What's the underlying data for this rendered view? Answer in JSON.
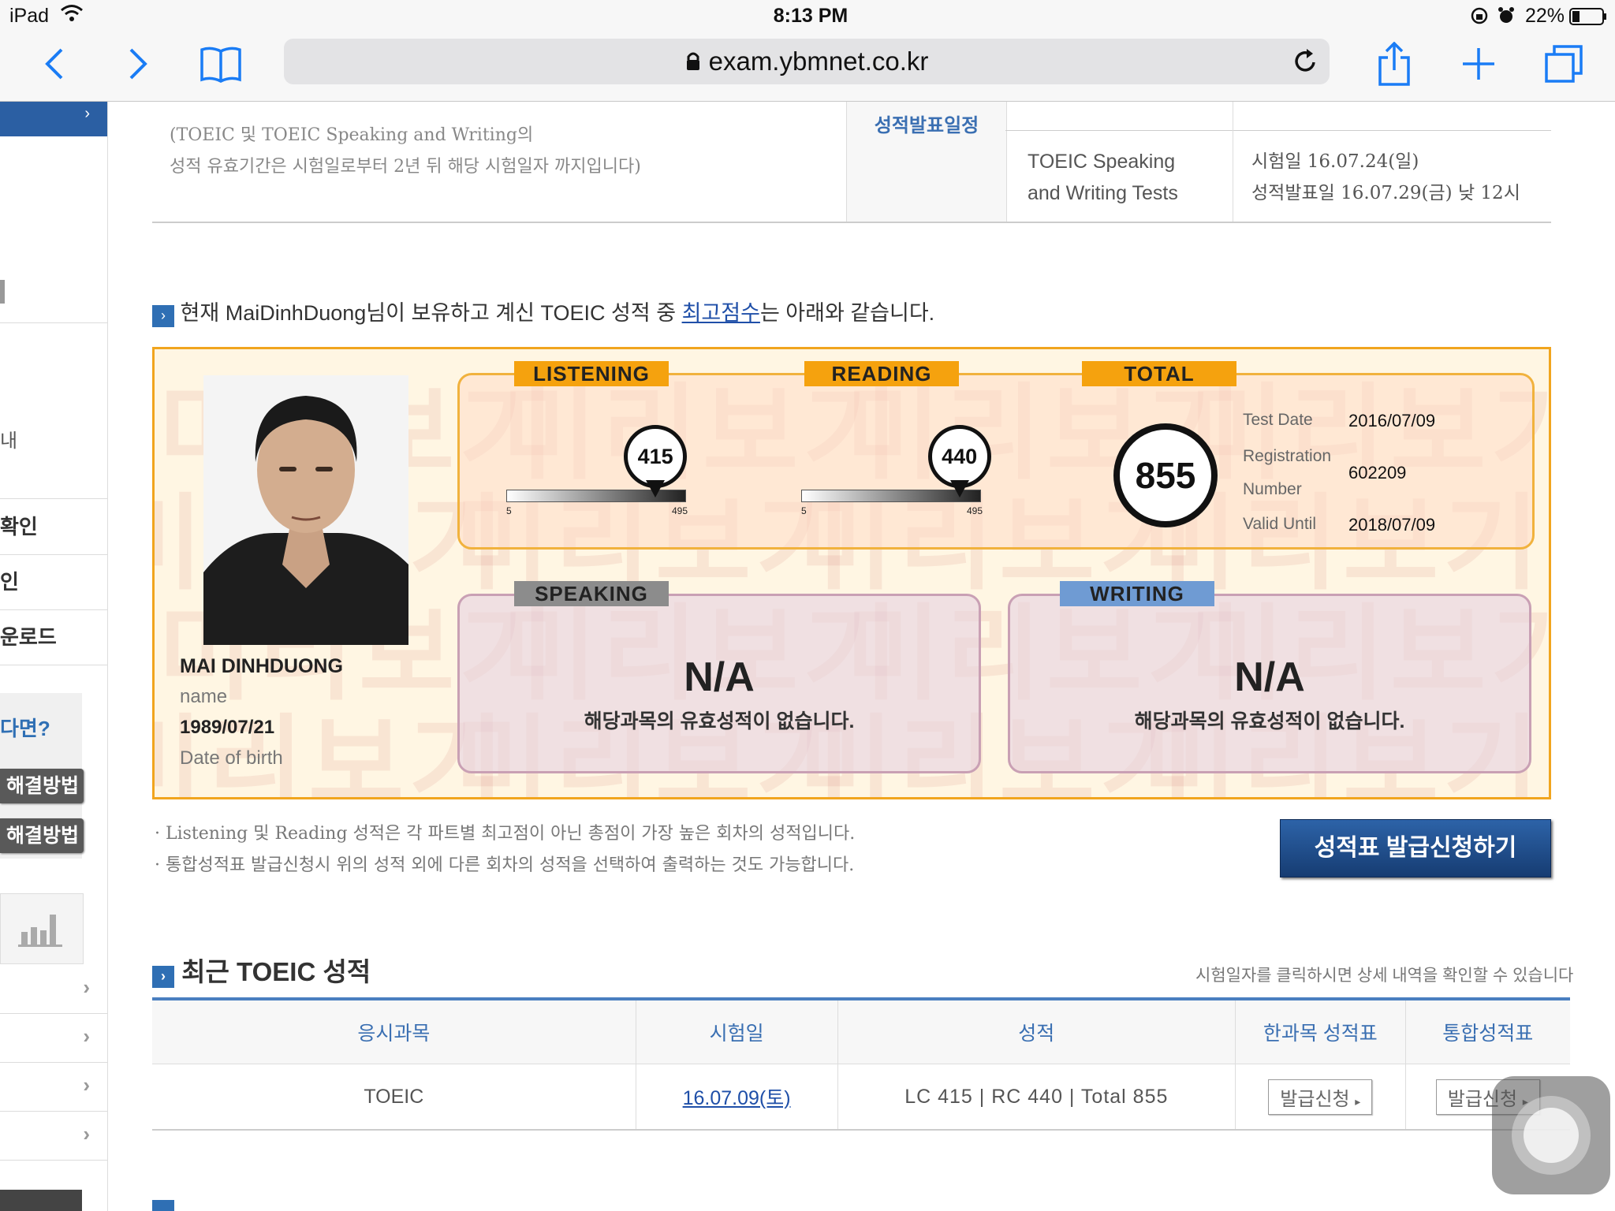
{
  "status_bar": {
    "device": "iPad",
    "time": "8:13 PM",
    "battery": "22%"
  },
  "browser": {
    "url": "exam.ybmnet.co.kr"
  },
  "top_section": {
    "validity_note_1": "(TOEIC 및 TOEIC Speaking and Writing의",
    "validity_note_2": "성적 유효기간은 시험일로부터 2년 뒤 해당 시험일자 까지입니다)",
    "schedule_header": "성적발표일정",
    "test_name_1": "TOEIC Speaking",
    "test_name_2": "and Writing Tests",
    "test_date": "시험일 16.07.24(일)",
    "result_date": "성적발표일 16.07.29(금) 낮 12시"
  },
  "best_score": {
    "intro_prefix": "현재 MaiDinhDuong님이 보유하고 계신 TOEIC 성적 중 ",
    "intro_link": "최고점수",
    "intro_suffix": "는 아래와 같습니다."
  },
  "score_card": {
    "watermark": "미리보기",
    "candidate_name": "MAI DINHDUONG",
    "name_label": "name",
    "dob": "1989/07/21",
    "dob_label": "Date of birth",
    "listening_label": "LISTENING",
    "reading_label": "READING",
    "total_label": "TOTAL",
    "listening_score": "415",
    "reading_score": "440",
    "total_score": "855",
    "scale_min": "5",
    "scale_max": "495",
    "listening_value": 415,
    "reading_value": 440,
    "test_date_label": "Test Date",
    "test_date": "2016/07/09",
    "registration_label_1": "Registration",
    "registration_label_2": "Number",
    "registration_number": "602209",
    "valid_until_label": "Valid Until",
    "valid_until": "2018/07/09",
    "speaking_label": "SPEAKING",
    "writing_label": "WRITING",
    "speaking_score": "N/A",
    "writing_score": "N/A",
    "no_score_msg": "해당과목의 유효성적이 없습니다."
  },
  "notes": {
    "note_1": "· Listening 및 Reading 성적은 각 파트별 최고점이 아닌 총점이 가장 높은 회차의 성적입니다.",
    "note_2": "· 통합성적표 발급신청시 위의 성적 외에 다른 회차의 성적을 선택하여 출력하는 것도 가능합니다.",
    "issue_button": "성적표 발급신청하기"
  },
  "recent": {
    "title": "최근 TOEIC 성적",
    "hint": "시험일자를 클릭하시면 상세 내역을 확인할 수 있습니다",
    "columns": [
      "응시과목",
      "시험일",
      "성적",
      "한과목 성적표",
      "통합성적표"
    ],
    "rows": [
      {
        "subject": "TOEIC",
        "date": "16.07.09(토)",
        "score": "LC 415 | RC 440 | Total 855",
        "single": "발급신청",
        "combined": "발급신청"
      }
    ]
  },
  "sidebar": {
    "items": [
      "확인",
      "인",
      "운로드"
    ],
    "question": "다면?",
    "btn_1": "해결방법",
    "btn_2": "해결방법",
    "partial_1": "내"
  },
  "colors": {
    "accent_blue": "#2f6fb4",
    "card_border": "#f1a51e",
    "button_navy": "#1d4a86"
  }
}
